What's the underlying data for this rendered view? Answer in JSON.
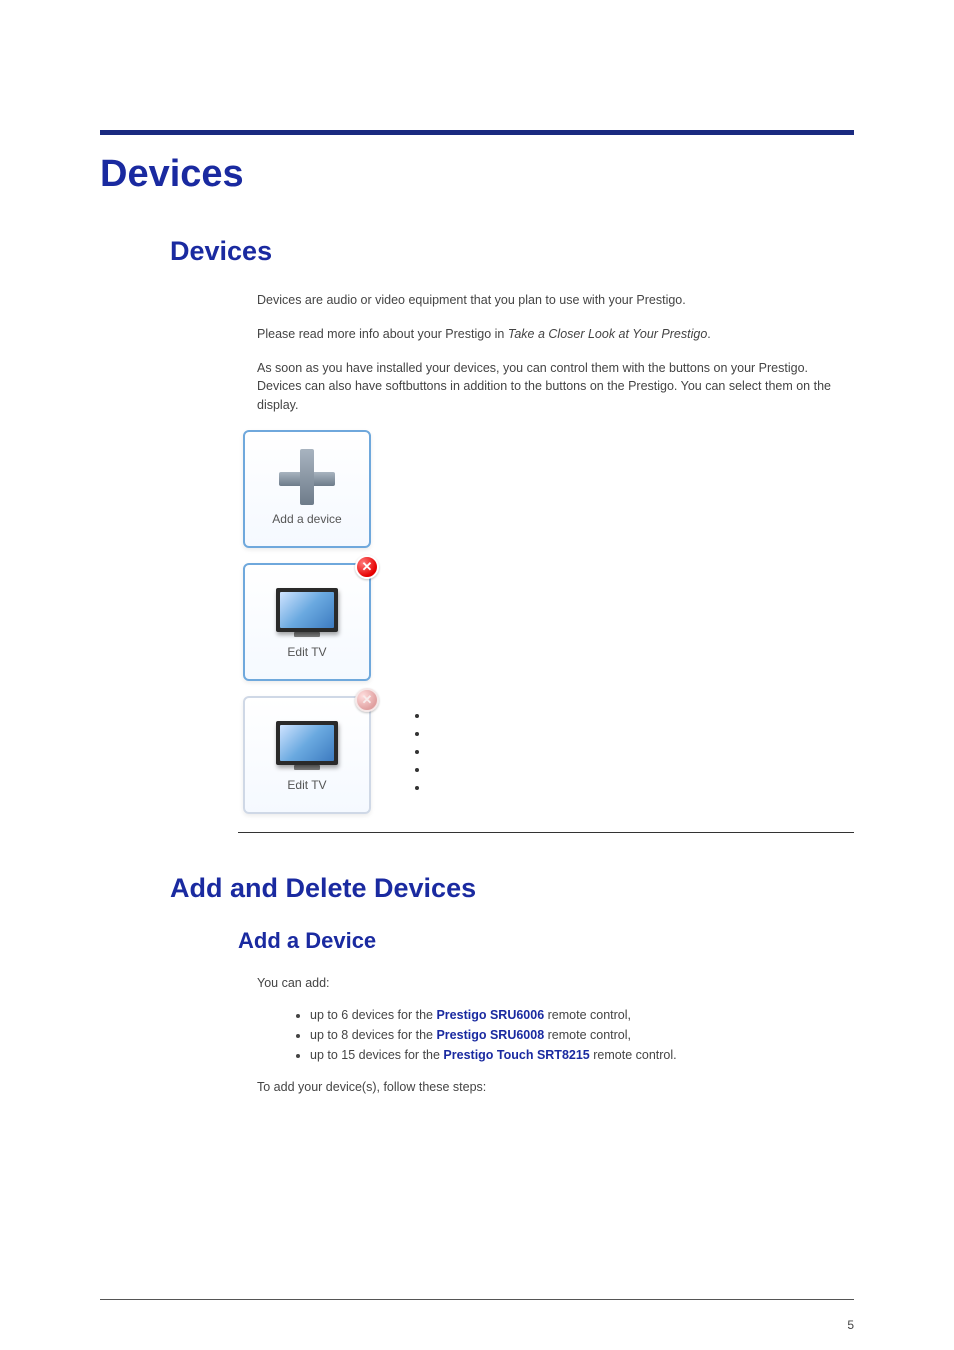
{
  "page": {
    "number": "5"
  },
  "h1": "Devices",
  "devices_section": {
    "title": "Devices",
    "p1": "Devices are audio or video equipment that you plan to use with your Prestigo.",
    "p2_a": "Please read more info about your Prestigo in ",
    "p2_link": "Take a Closer Look at Your Prestigo",
    "p2_b": ".",
    "p3": "As soon as you have installed your devices, you can control them with the buttons on your Prestigo. Devices can also have softbuttons in addition to the buttons on the Prestigo. You can select them on the display.",
    "tile_add": "Add a device",
    "tile_edit1": "Edit TV",
    "tile_edit2": "Edit TV",
    "delete_glyph": "✕"
  },
  "add_delete_section": {
    "title": "Add and Delete Devices",
    "sub_title": "Add a Device",
    "intro": "You can add:",
    "li1_a": "up to 6 devices for the ",
    "li1_b": "Prestigo SRU6006",
    "li1_c": " remote control,",
    "li2_a": "up to 8 devices for the ",
    "li2_b": "Prestigo SRU6008",
    "li2_c": " remote control,",
    "li3_a": "up to 15 devices for the ",
    "li3_b": "Prestigo Touch SRT8215",
    "li3_c": " remote control.",
    "outro": "To add your device(s), follow these steps:"
  }
}
